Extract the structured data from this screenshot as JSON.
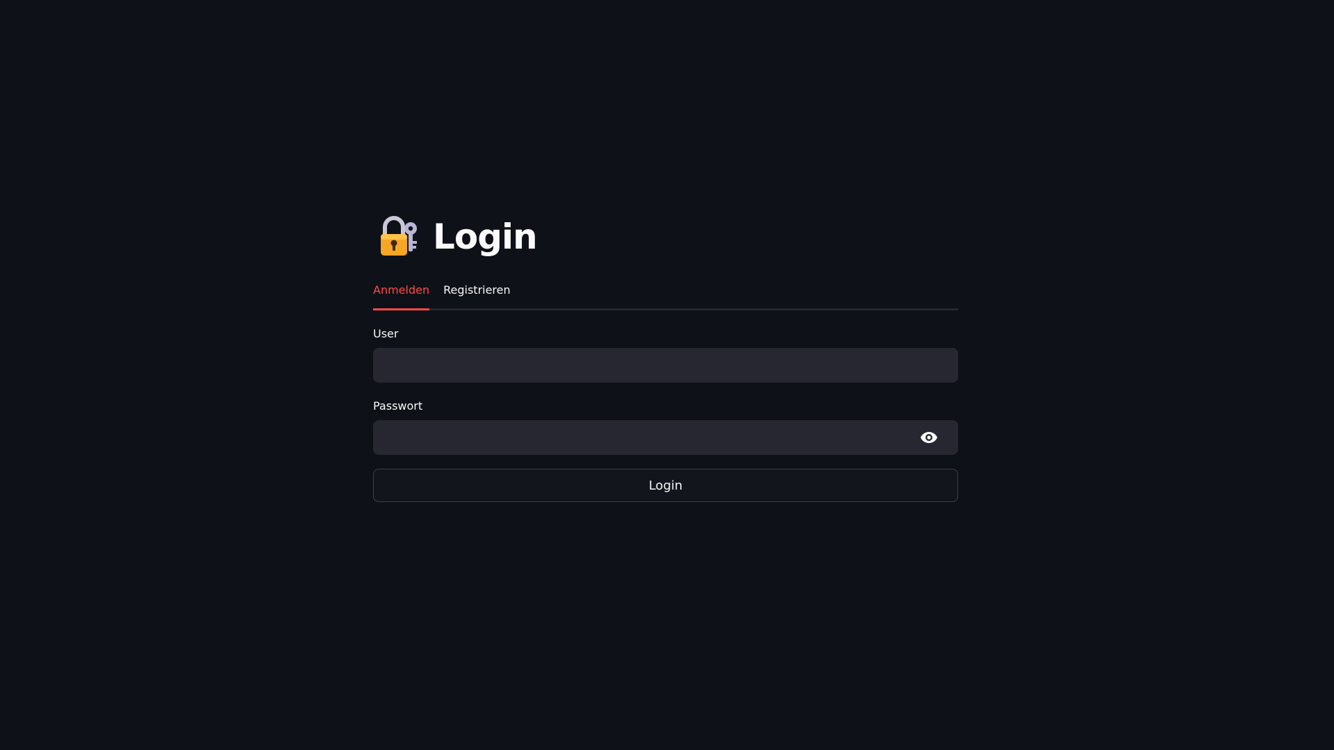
{
  "header": {
    "icon": "locked-with-key-icon",
    "title": "Login"
  },
  "tabs": [
    {
      "label": "Anmelden",
      "active": true
    },
    {
      "label": "Registrieren",
      "active": false
    }
  ],
  "form": {
    "user": {
      "label": "User",
      "value": "",
      "placeholder": ""
    },
    "password": {
      "label": "Passwort",
      "value": "",
      "placeholder": "",
      "toggle_icon": "eye-icon"
    },
    "submit_label": "Login"
  },
  "colors": {
    "background": "#0e1117",
    "accent": "#ff4b4b",
    "input_bg": "#262730",
    "text": "#fafafa"
  }
}
